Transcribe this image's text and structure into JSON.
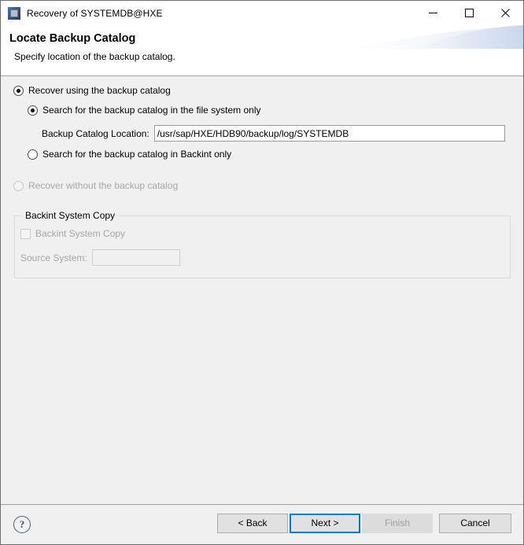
{
  "window": {
    "title": "Recovery of SYSTEMDB@HXE",
    "icon": "app-icon",
    "controls": {
      "minimize": "minimize-icon",
      "maximize": "maximize-icon",
      "close": "close-icon"
    }
  },
  "header": {
    "title": "Locate Backup Catalog",
    "subtitle": "Specify location of the backup catalog."
  },
  "main": {
    "options": {
      "recover_with_catalog": {
        "label": "Recover using the backup catalog",
        "checked": true,
        "enabled": true
      },
      "search_file_system": {
        "label": "Search for the backup catalog in the file system only",
        "checked": true,
        "enabled": true
      },
      "catalog_location": {
        "label": "Backup Catalog Location:",
        "value": "/usr/sap/HXE/HDB90/backup/log/SYSTEMDB",
        "placeholder": ""
      },
      "search_backint": {
        "label": "Search for the backup catalog in Backint only",
        "checked": false,
        "enabled": true
      },
      "recover_without_catalog": {
        "label": "Recover without the backup catalog",
        "checked": false,
        "enabled": false
      }
    },
    "backint_group": {
      "title": "Backint System Copy",
      "checkbox_label": "Backint System Copy",
      "checkbox_checked": false,
      "source_system_label": "Source System:",
      "source_system_value": "",
      "source_system_placeholder": ""
    }
  },
  "footer": {
    "help_label": "?",
    "back_label": "< Back",
    "next_label": "Next >",
    "finish_label": "Finish",
    "cancel_label": "Cancel"
  },
  "colors": {
    "focus_blue": "#0078d7",
    "body_gray": "#f0f0f0",
    "disabled_text": "#a6a6a6"
  }
}
